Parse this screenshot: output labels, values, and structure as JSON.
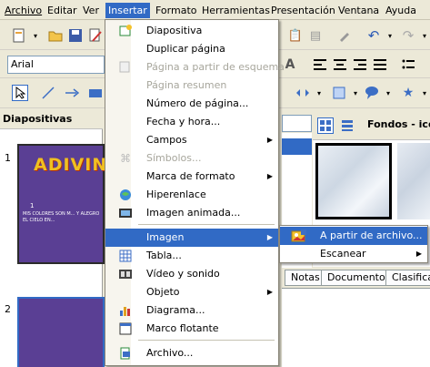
{
  "menubar": {
    "items": [
      {
        "label": "Archivo"
      },
      {
        "label": "Editar"
      },
      {
        "label": "Ver"
      },
      {
        "label": "Insertar"
      },
      {
        "label": "Formato"
      },
      {
        "label": "Herramientas"
      },
      {
        "label": "Presentación"
      },
      {
        "label": "Ventana"
      },
      {
        "label": "Ayuda"
      }
    ]
  },
  "format_toolbar": {
    "font_name": "Arial"
  },
  "slides_pane": {
    "title": "Diapositivas",
    "slide1_number": "1",
    "slide2_number": "2",
    "slide1_title": "ADIVINA",
    "slide1_body": "MIS COLORES SON M... Y ALEGRO EL CIELO EN...",
    "slide1_bullet": "1"
  },
  "right_pane": {
    "header": "Fondos - ice-",
    "tabs": [
      "Notas",
      "Documento",
      "Clasifica"
    ]
  },
  "insert_menu": {
    "items": [
      {
        "label": "Diapositiva",
        "icon": "new-slide-icon",
        "enabled": true
      },
      {
        "label": "Duplicar página",
        "icon": "",
        "enabled": true
      },
      {
        "label": "Página a partir de esquema",
        "icon": "",
        "enabled": false
      },
      {
        "label": "Página resumen",
        "icon": "",
        "enabled": false
      },
      {
        "label": "Número de página...",
        "icon": "",
        "enabled": true
      },
      {
        "label": "Fecha y hora...",
        "icon": "",
        "enabled": true
      },
      {
        "label": "Campos",
        "icon": "",
        "enabled": true,
        "submenu": true
      },
      {
        "label": "Símbolos...",
        "icon": "symbol-icon",
        "enabled": false
      },
      {
        "label": "Marca de formato",
        "icon": "",
        "enabled": true,
        "submenu": true
      },
      {
        "label": "Hiperenlace",
        "icon": "hyperlink-icon",
        "enabled": true
      },
      {
        "label": "Imagen animada...",
        "icon": "animated-image-icon",
        "enabled": true
      },
      {
        "label": "Imagen",
        "icon": "",
        "enabled": true,
        "submenu": true,
        "highlighted": true
      },
      {
        "label": "Tabla...",
        "icon": "table-icon",
        "enabled": true
      },
      {
        "label": "Vídeo y sonido",
        "icon": "movie-icon",
        "enabled": true
      },
      {
        "label": "Objeto",
        "icon": "",
        "enabled": true,
        "submenu": true
      },
      {
        "label": "Diagrama...",
        "icon": "chart-icon",
        "enabled": true
      },
      {
        "label": "Marco flotante",
        "icon": "frame-icon",
        "enabled": true
      },
      {
        "label": "Archivo...",
        "icon": "insert-file-icon",
        "enabled": true
      }
    ]
  },
  "image_submenu": {
    "items": [
      {
        "label": "A partir de archivo...",
        "icon": "image-from-file-icon",
        "highlighted": true
      },
      {
        "label": "Escanear",
        "submenu": true
      }
    ]
  },
  "colors": {
    "menu_highlight": "#316ac5",
    "slide_bg": "#5a3f94",
    "toolbar_bg": "#ece9d8"
  }
}
